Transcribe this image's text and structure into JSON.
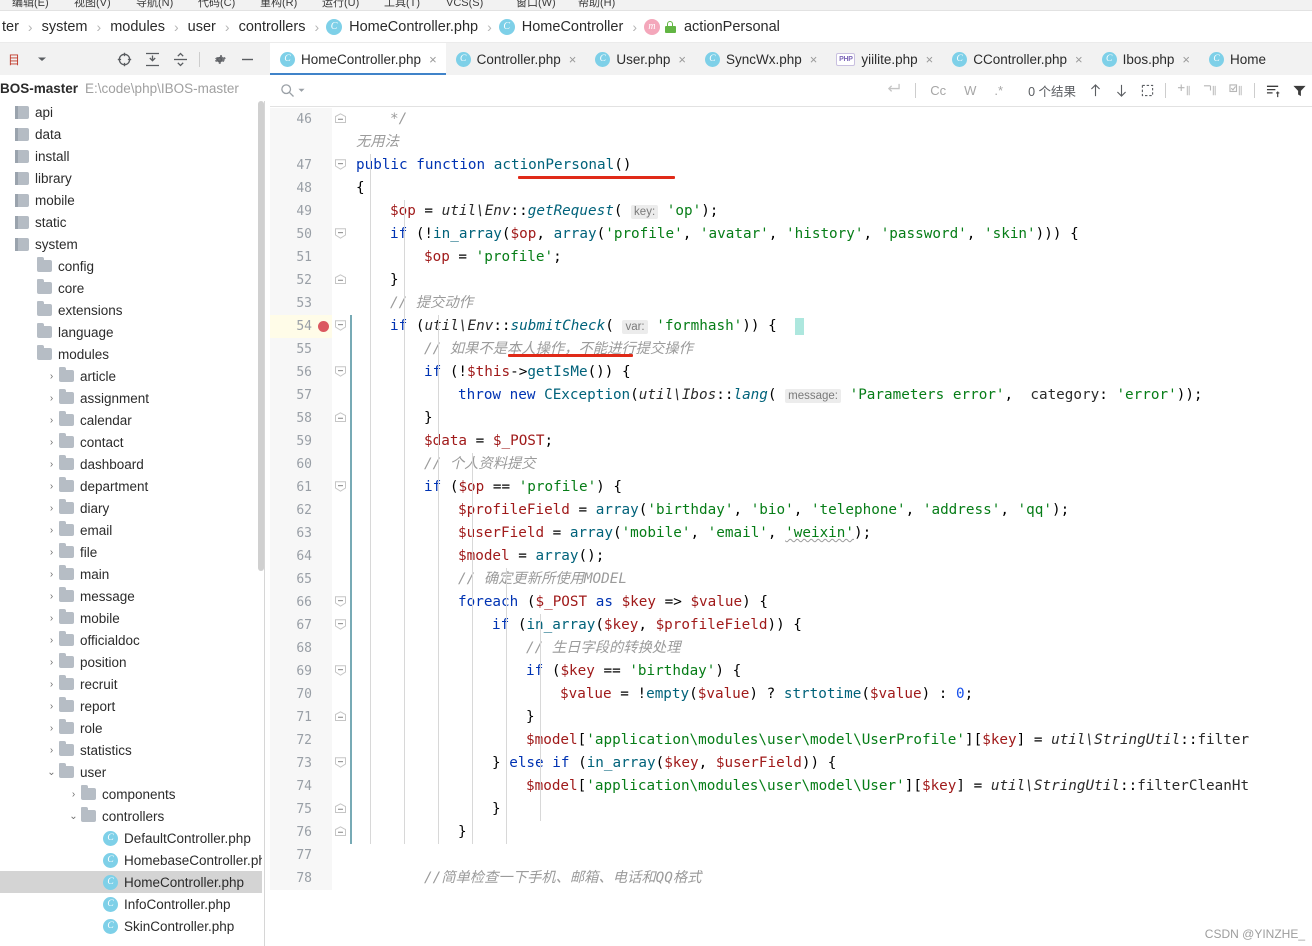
{
  "menu_strip": {
    "items": [
      "编辑(E)",
      "视图(V)",
      "导航(N)",
      "代码(C)",
      "重构(R)",
      "运行(U)",
      "工具(T)",
      "VCS(S)",
      "窗口(W)",
      "帮助(H)"
    ]
  },
  "breadcrumb": {
    "items": [
      {
        "label": "ter",
        "icon": "none"
      },
      {
        "label": "system",
        "icon": "none"
      },
      {
        "label": "modules",
        "icon": "none"
      },
      {
        "label": "user",
        "icon": "none"
      },
      {
        "label": "controllers",
        "icon": "none"
      },
      {
        "label": "HomeController.php",
        "icon": "class-icon"
      },
      {
        "label": "HomeController",
        "icon": "class-icon"
      },
      {
        "label": "actionPersonal",
        "icon": "method-icon"
      }
    ]
  },
  "project_toolbar": {
    "icons": [
      "project-select-dropdown",
      "locate-target-icon",
      "expand-all-icon",
      "collapse-all-icon",
      "settings-gear-icon",
      "hide-panel-icon"
    ]
  },
  "editor_tabs": [
    {
      "label": "HomeController.php",
      "icon": "php-class-icon",
      "active": true,
      "close": "×"
    },
    {
      "label": "Controller.php",
      "icon": "php-class-icon",
      "active": false,
      "close": "×"
    },
    {
      "label": "User.php",
      "icon": "php-class-icon",
      "active": false,
      "close": "×"
    },
    {
      "label": "SyncWx.php",
      "icon": "php-class-icon",
      "active": false,
      "close": "×"
    },
    {
      "label": "yiilite.php",
      "icon": "php-file-icon",
      "active": false,
      "close": "×"
    },
    {
      "label": "CController.php",
      "icon": "php-class-icon",
      "active": false,
      "close": "×"
    },
    {
      "label": "Ibos.php",
      "icon": "php-class-icon",
      "active": false,
      "close": "×"
    },
    {
      "label": "Home",
      "icon": "php-class-icon",
      "active": false,
      "close": ""
    }
  ],
  "project_panel": {
    "name": "BOS-master",
    "path": "E:\\code\\php\\IBOS-master"
  },
  "search_toolbar": {
    "placeholder": "",
    "value": "",
    "search_icon": "magnifier-icon",
    "dropdown_icon": "chevron-down-icon",
    "buttons": [
      "regex-newline-icon",
      "Cc",
      "W",
      ".*"
    ],
    "result_count": "0 个结果",
    "nav_icons": [
      "arrow-up-icon",
      "arrow-down-icon",
      "select-all-icon",
      "add-line-icon",
      "remove-line-icon",
      "check-lines-icon",
      "filter-lines-icon",
      "filter-icon"
    ]
  },
  "tree": [
    {
      "indent": 0,
      "arrow": "",
      "icon": "module-icon",
      "label": "api"
    },
    {
      "indent": 0,
      "arrow": "",
      "icon": "module-icon",
      "label": "data"
    },
    {
      "indent": 0,
      "arrow": "",
      "icon": "module-icon",
      "label": "install"
    },
    {
      "indent": 0,
      "arrow": "",
      "icon": "module-icon",
      "label": "library"
    },
    {
      "indent": 0,
      "arrow": "",
      "icon": "module-icon",
      "label": "mobile"
    },
    {
      "indent": 0,
      "arrow": "",
      "icon": "module-icon",
      "label": "static"
    },
    {
      "indent": 0,
      "arrow": "",
      "icon": "module-icon",
      "label": "system"
    },
    {
      "indent": 1,
      "arrow": "",
      "icon": "folder-icon",
      "label": "config"
    },
    {
      "indent": 1,
      "arrow": "",
      "icon": "folder-icon",
      "label": "core"
    },
    {
      "indent": 1,
      "arrow": "",
      "icon": "folder-icon",
      "label": "extensions"
    },
    {
      "indent": 1,
      "arrow": "",
      "icon": "folder-icon",
      "label": "language"
    },
    {
      "indent": 1,
      "arrow": "",
      "icon": "folder-icon",
      "label": "modules"
    },
    {
      "indent": 2,
      "arrow": "›",
      "icon": "folder-icon",
      "label": "article"
    },
    {
      "indent": 2,
      "arrow": "›",
      "icon": "folder-icon",
      "label": "assignment"
    },
    {
      "indent": 2,
      "arrow": "›",
      "icon": "folder-icon",
      "label": "calendar"
    },
    {
      "indent": 2,
      "arrow": "›",
      "icon": "folder-icon",
      "label": "contact"
    },
    {
      "indent": 2,
      "arrow": "›",
      "icon": "folder-icon",
      "label": "dashboard"
    },
    {
      "indent": 2,
      "arrow": "›",
      "icon": "folder-icon",
      "label": "department"
    },
    {
      "indent": 2,
      "arrow": "›",
      "icon": "folder-icon",
      "label": "diary"
    },
    {
      "indent": 2,
      "arrow": "›",
      "icon": "folder-icon",
      "label": "email"
    },
    {
      "indent": 2,
      "arrow": "›",
      "icon": "folder-icon",
      "label": "file"
    },
    {
      "indent": 2,
      "arrow": "›",
      "icon": "folder-icon",
      "label": "main"
    },
    {
      "indent": 2,
      "arrow": "›",
      "icon": "folder-icon",
      "label": "message"
    },
    {
      "indent": 2,
      "arrow": "›",
      "icon": "folder-icon",
      "label": "mobile"
    },
    {
      "indent": 2,
      "arrow": "›",
      "icon": "folder-icon",
      "label": "officialdoc"
    },
    {
      "indent": 2,
      "arrow": "›",
      "icon": "folder-icon",
      "label": "position"
    },
    {
      "indent": 2,
      "arrow": "›",
      "icon": "folder-icon",
      "label": "recruit"
    },
    {
      "indent": 2,
      "arrow": "›",
      "icon": "folder-icon",
      "label": "report"
    },
    {
      "indent": 2,
      "arrow": "›",
      "icon": "folder-icon",
      "label": "role"
    },
    {
      "indent": 2,
      "arrow": "›",
      "icon": "folder-icon",
      "label": "statistics"
    },
    {
      "indent": 2,
      "arrow": "⌄",
      "icon": "folder-icon",
      "label": "user"
    },
    {
      "indent": 3,
      "arrow": "›",
      "icon": "folder-icon",
      "label": "components"
    },
    {
      "indent": 3,
      "arrow": "⌄",
      "icon": "folder-icon",
      "label": "controllers"
    },
    {
      "indent": 4,
      "arrow": "",
      "icon": "php-class-icon",
      "label": "DefaultController.php"
    },
    {
      "indent": 4,
      "arrow": "",
      "icon": "php-class-icon",
      "label": "HomebaseController.php"
    },
    {
      "indent": 4,
      "arrow": "",
      "icon": "php-class-icon",
      "label": "HomeController.php",
      "selected": true
    },
    {
      "indent": 4,
      "arrow": "",
      "icon": "php-class-icon",
      "label": "InfoController.php"
    },
    {
      "indent": 4,
      "arrow": "",
      "icon": "php-class-icon",
      "label": "SkinController.php"
    }
  ],
  "editor": {
    "first_line": 46,
    "current_line": 54,
    "breakpoint_line": 54,
    "lines": [
      {
        "n": 46,
        "fold": "minus-square",
        "indent": 1,
        "code": "*/"
      },
      {
        "n": "",
        "fold": "",
        "indent": 0,
        "code": "无用法",
        "nonum": true
      },
      {
        "n": 47,
        "fold": "minus-round",
        "indent": 0,
        "code": "public function actionPersonal()"
      },
      {
        "n": 48,
        "fold": "",
        "indent": 0,
        "code": "{"
      },
      {
        "n": 49,
        "fold": "",
        "indent": 1,
        "code": "$op = util\\Env::getRequest( key: 'op');"
      },
      {
        "n": 50,
        "fold": "minus-round",
        "indent": 1,
        "code": "if (!in_array($op, array('profile', 'avatar', 'history', 'password', 'skin'))) {"
      },
      {
        "n": 51,
        "fold": "",
        "indent": 2,
        "code": "$op = 'profile';"
      },
      {
        "n": 52,
        "fold": "minus-square",
        "indent": 1,
        "code": "}"
      },
      {
        "n": 53,
        "fold": "",
        "indent": 1,
        "code": "// 提交动作"
      },
      {
        "n": 54,
        "fold": "minus-round",
        "indent": 1,
        "code": "if (util\\Env::submitCheck( var: 'formhash')) {",
        "current": true
      },
      {
        "n": 55,
        "fold": "",
        "indent": 2,
        "code": "// 如果不是本人操作，不能进行提交操作"
      },
      {
        "n": 56,
        "fold": "minus-round",
        "indent": 2,
        "code": "if (!$this->getIsMe()) {"
      },
      {
        "n": 57,
        "fold": "",
        "indent": 3,
        "code": "throw new CException(util\\Ibos::lang( message: 'Parameters error',  category: 'error'));"
      },
      {
        "n": 58,
        "fold": "minus-square",
        "indent": 2,
        "code": "}"
      },
      {
        "n": 59,
        "fold": "",
        "indent": 2,
        "code": "$data = $_POST;"
      },
      {
        "n": 60,
        "fold": "",
        "indent": 2,
        "code": "// 个人资料提交"
      },
      {
        "n": 61,
        "fold": "minus-round",
        "indent": 2,
        "code": "if ($op == 'profile') {"
      },
      {
        "n": 62,
        "fold": "",
        "indent": 3,
        "code": "$profileField = array('birthday', 'bio', 'telephone', 'address', 'qq');"
      },
      {
        "n": 63,
        "fold": "",
        "indent": 3,
        "code": "$userField = array('mobile', 'email', 'weixin');"
      },
      {
        "n": 64,
        "fold": "",
        "indent": 3,
        "code": "$model = array();"
      },
      {
        "n": 65,
        "fold": "",
        "indent": 3,
        "code": "// 确定更新所使用MODEL"
      },
      {
        "n": 66,
        "fold": "minus-round",
        "indent": 3,
        "code": "foreach ($_POST as $key => $value) {"
      },
      {
        "n": 67,
        "fold": "minus-round",
        "indent": 4,
        "code": "if (in_array($key, $profileField)) {"
      },
      {
        "n": 68,
        "fold": "",
        "indent": 5,
        "code": "// 生日字段的转换处理"
      },
      {
        "n": 69,
        "fold": "minus-round",
        "indent": 5,
        "code": "if ($key == 'birthday') {"
      },
      {
        "n": 70,
        "fold": "",
        "indent": 6,
        "code": "$value = !empty($value) ? strtotime($value) : 0;"
      },
      {
        "n": 71,
        "fold": "minus-square",
        "indent": 5,
        "code": "}"
      },
      {
        "n": 72,
        "fold": "",
        "indent": 5,
        "code": "$model['application\\modules\\user\\model\\UserProfile'][$key] = util\\StringUtil::filter"
      },
      {
        "n": 73,
        "fold": "minus-round",
        "indent": 4,
        "code": "} else if (in_array($key, $userField)) {"
      },
      {
        "n": 74,
        "fold": "",
        "indent": 5,
        "code": "$model['application\\modules\\user\\model\\User'][$key] = util\\StringUtil::filterCleanHt"
      },
      {
        "n": 75,
        "fold": "minus-square",
        "indent": 4,
        "code": "}"
      },
      {
        "n": 76,
        "fold": "minus-square",
        "indent": 3,
        "code": "}"
      },
      {
        "n": 77,
        "fold": "",
        "indent": 0,
        "code": ""
      },
      {
        "n": 78,
        "fold": "",
        "indent": 2,
        "code": "//简单检查一下手机、邮箱、电话和QQ格式"
      }
    ],
    "annotations": [
      {
        "type": "red-underline",
        "target": "actionPersonal()"
      },
      {
        "type": "red-underline",
        "target": "submitCheck("
      }
    ]
  },
  "watermark": "CSDN @YINZHE_"
}
